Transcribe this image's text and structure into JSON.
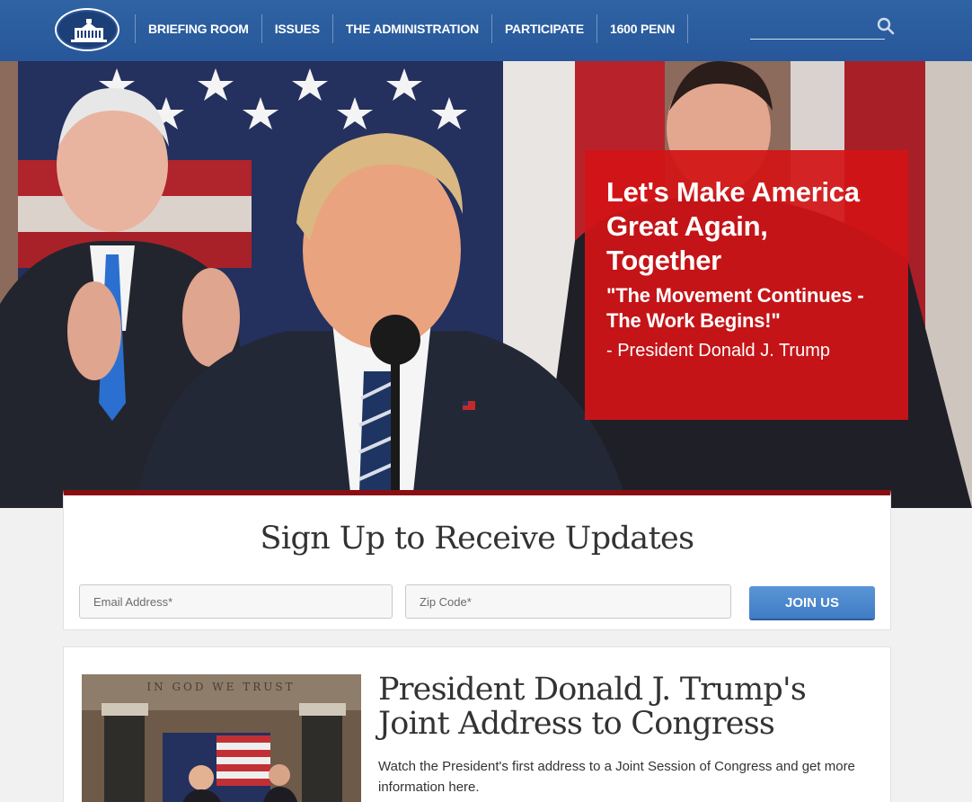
{
  "nav": {
    "items": [
      {
        "label": "BRIEFING ROOM"
      },
      {
        "label": "ISSUES"
      },
      {
        "label": "THE ADMINISTRATION"
      },
      {
        "label": "PARTICIPATE"
      },
      {
        "label": "1600 PENN"
      }
    ],
    "search_placeholder": "",
    "logo_icon": "white-house-seal-icon",
    "search_icon": "magnifier-icon",
    "color": "#2b5c9f"
  },
  "hero": {
    "headline": "Let's Make America Great Again, Together",
    "quote": "\"The Movement Continues - The Work Begins!\"",
    "attribution": "- President Donald J. Trump",
    "callout_color": "#d21416"
  },
  "signup": {
    "title": "Sign Up to Receive Updates",
    "email_placeholder": "Email Address*",
    "zip_placeholder": "Zip Code*",
    "button_label": "JOIN US",
    "accent_color": "#8a0f14",
    "button_color": "#4a88cc"
  },
  "feature": {
    "inscription": "IN GOD WE TRUST",
    "title": "President Donald J. Trump's Joint Address to Congress",
    "description": "Watch the President's first address to a Joint Session of Congress and get more information here."
  }
}
